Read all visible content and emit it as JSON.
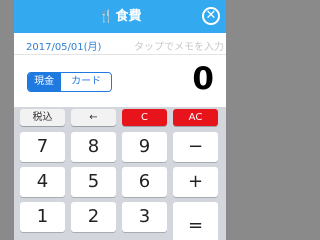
{
  "header": {
    "fork_icon": "fork-knife-icon",
    "title": "食費",
    "close_icon": "close-circle-icon"
  },
  "date_row": {
    "date": "2017/05/01(月)",
    "memo_placeholder": "タップでメモを入力"
  },
  "payment": {
    "options": [
      "現金",
      "カード"
    ],
    "selected": "現金"
  },
  "amount": "0",
  "function_keys": [
    {
      "label": "税込",
      "style": "gray"
    },
    {
      "label": "←",
      "style": "gray"
    },
    {
      "label": "C",
      "style": "red"
    },
    {
      "label": "AC",
      "style": "red"
    }
  ],
  "keys": {
    "k7": "7",
    "k8": "8",
    "k9": "9",
    "minus": "−",
    "k4": "4",
    "k5": "5",
    "k6": "6",
    "plus": "+",
    "k1": "1",
    "k2": "2",
    "k3": "3",
    "equals": "="
  },
  "colors": {
    "header": "#33aaf0",
    "accent": "#1f7ae0",
    "danger": "#e8141c"
  }
}
